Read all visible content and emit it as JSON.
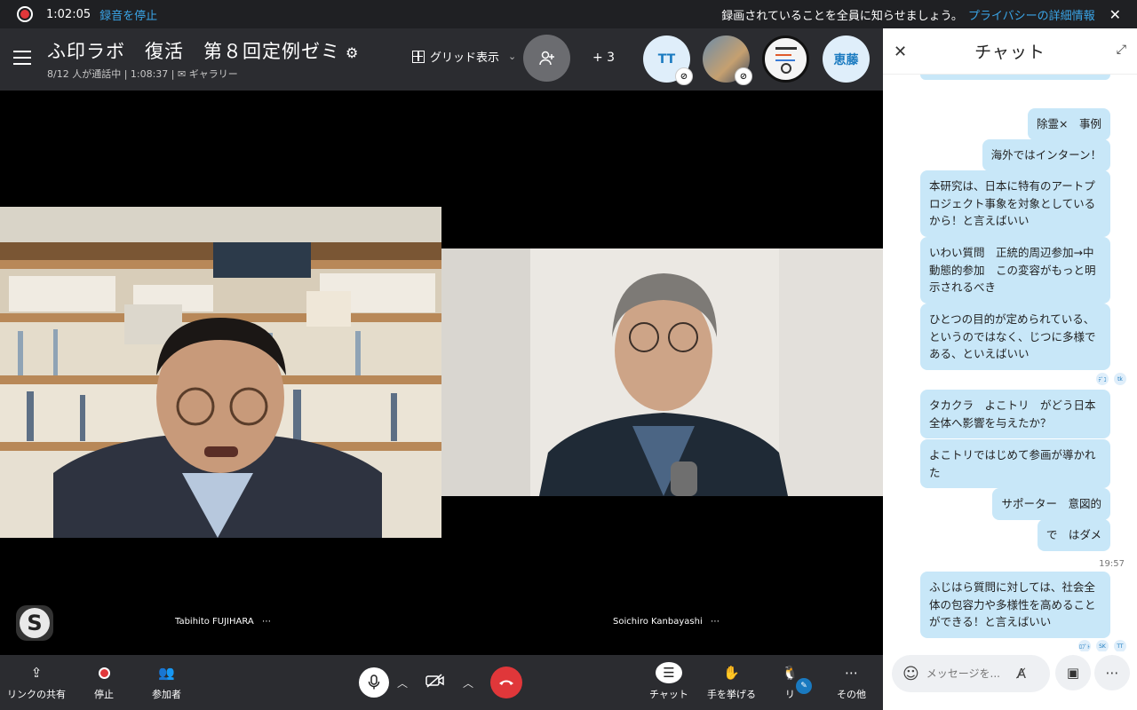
{
  "recording": {
    "time": "1:02:05",
    "stop_label": "録音を停止",
    "notice": "録画されていることを全員に知らせましょう。",
    "privacy_link": "プライバシーの詳細情報",
    "close": "✕"
  },
  "header": {
    "title": "ふ印ラボ　復活　第８回定例ゼミ",
    "subtitle": "8/12 人が通話中 | 1:08:37 |  ✉ ギャラリー",
    "grid_label": "グリッド表示",
    "chevron": "⌄",
    "plus_count": "+ 3",
    "avatars": [
      "TT",
      "恵藤"
    ]
  },
  "video": {
    "participants": [
      {
        "name": "Tabihito FUJIHARA",
        "more": "⋯"
      },
      {
        "name": "Soichiro Kanbayashi",
        "more": "⋯"
      }
    ]
  },
  "toolbar": {
    "share_link": "リンクの共有",
    "stop": "停止",
    "participants": "参加者",
    "chat": "チャット",
    "raise_hand": "手を挙げる",
    "react": "リ",
    "more": "その他"
  },
  "chat": {
    "title": "チャット",
    "messages": [
      "除霊×　事例",
      "海外ではインターン！",
      "本研究は、日本に特有のアートプロジェクト事象を対象としているから！と言えばいい",
      "いわい質問　正統的周辺参加→中動態的参加　この変容がもっと明示されるべき",
      "ひとつの目的が定められている、というのではなく、じつに多様である、といえばいい",
      "タカクラ　よこトリ　がどう日本全体へ影響を与えたか？",
      "よこトリではじめて参画が導かれた",
      "サポーター　意図的",
      "で　はダメ",
      "ふじはら質問に対しては、社会全体の包容力や多様性を高めることができる！と言えばいい"
    ],
    "timestamp": "19:57",
    "read_receipts_1": [
      "ﾃﾞｺ",
      "tk"
    ],
    "read_receipts_2": [
      "ﾛﾌﾟﾄ",
      "SK",
      "TT"
    ],
    "input_placeholder": "メッセージを..."
  },
  "colors": {
    "accent": "#3aa5e8",
    "bubble": "#c8e7f8",
    "hangup": "#e0373a",
    "header_bg": "#2b2c30"
  }
}
